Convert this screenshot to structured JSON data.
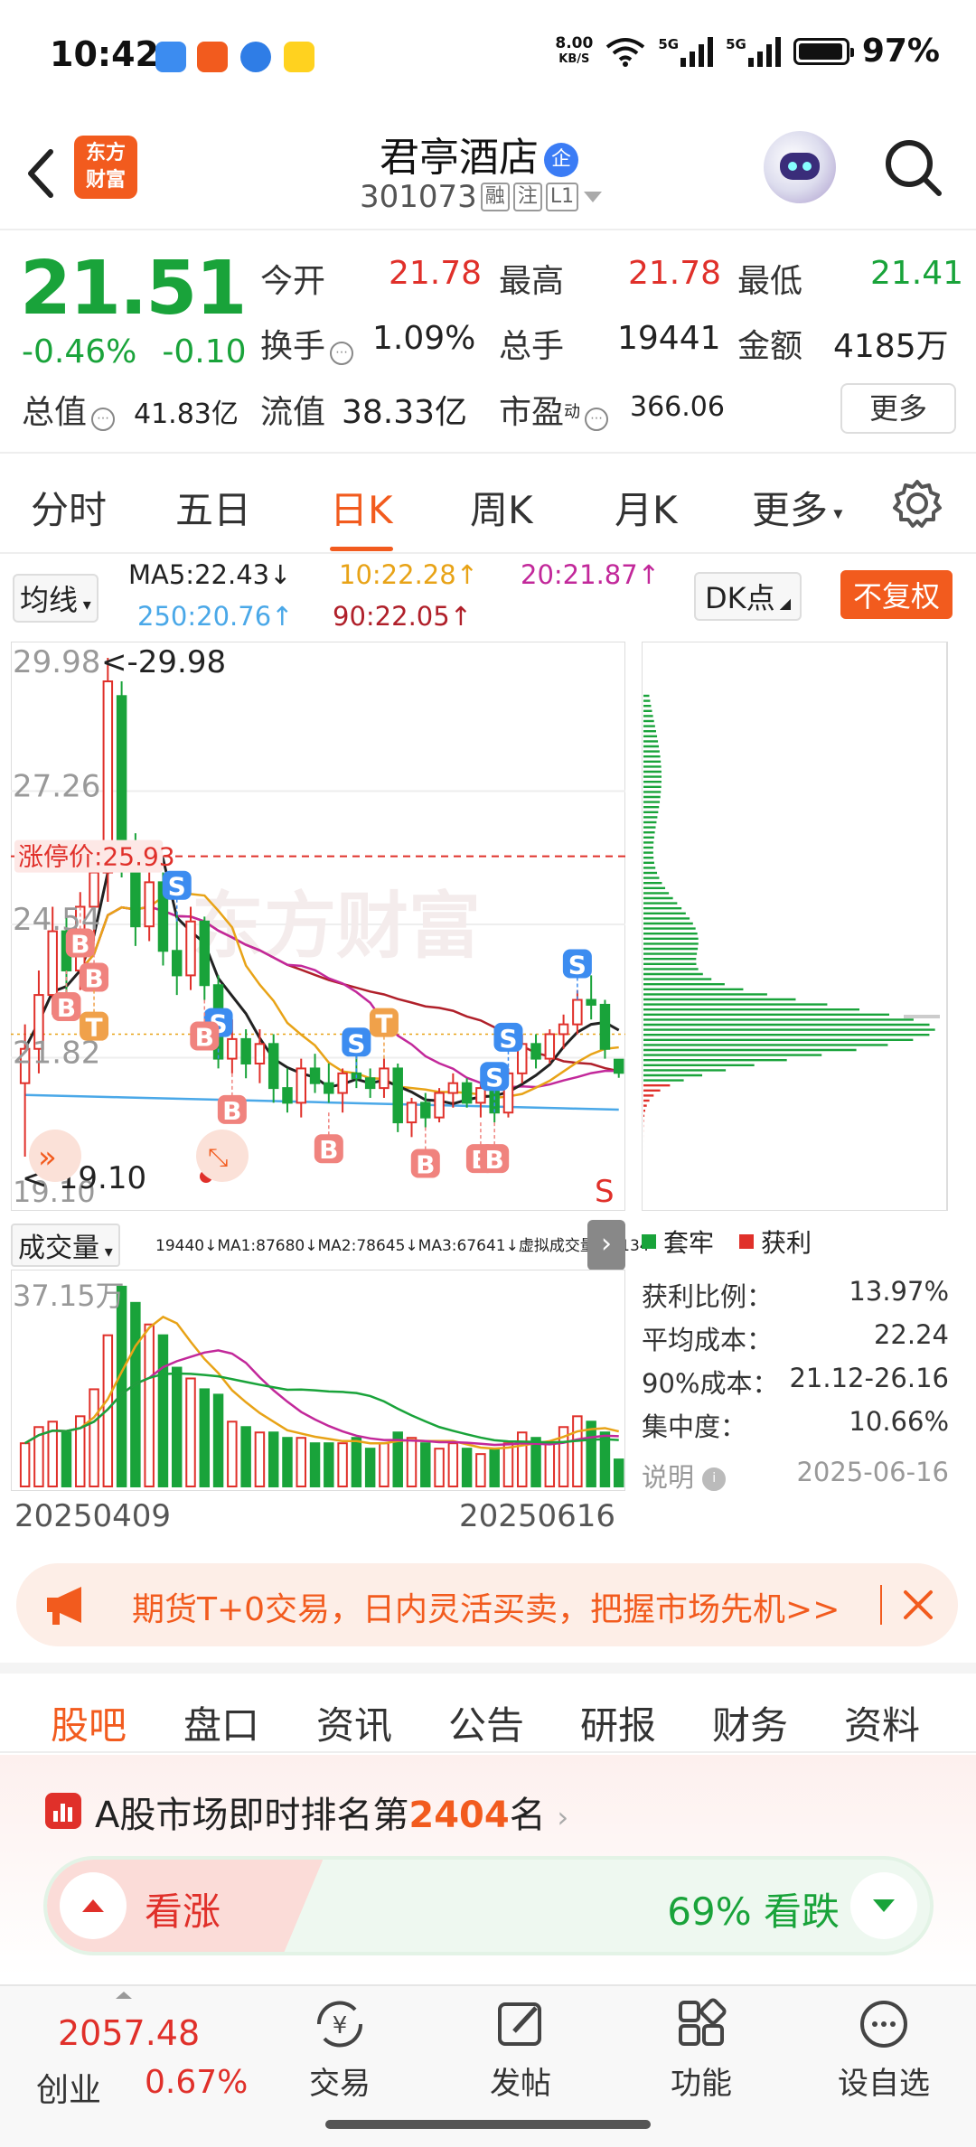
{
  "status_bar": {
    "time": "10:42",
    "net_speed": "8.00",
    "net_unit": "KB/S",
    "signal1": "5G",
    "signal2": "5G",
    "battery": "97%",
    "battery_level": 0.97
  },
  "header": {
    "back_icon": "chevron-left-icon",
    "logo_line1": "东方",
    "logo_line2": "财富",
    "stock_name": "君亭酒店",
    "name_badge": "企",
    "stock_code": "301073",
    "tags": [
      "融",
      "注",
      "L1"
    ],
    "assistant_icon": "robot-avatar-icon",
    "search_icon": "search-icon"
  },
  "quote": {
    "price": "21.51",
    "change_pct": "-0.46%",
    "change": "-0.10",
    "open_label": "今开",
    "open": "21.78",
    "high_label": "最高",
    "high": "21.78",
    "low_label": "最低",
    "low": "21.41",
    "turnover_label": "换手",
    "turnover": "1.09%",
    "volume_label": "总手",
    "volume": "19441",
    "amount_label": "金额",
    "amount": "4185万",
    "mktcap_label": "总值",
    "mktcap": "41.83亿",
    "float_label": "流值",
    "float_cap": "38.33亿",
    "pe_label": "市盈",
    "pe_sup": "动",
    "pe": "366.06",
    "more_button": "更多",
    "colors": {
      "up": "#e0302a",
      "down": "#19a33a",
      "accent": "#f25b1e"
    }
  },
  "period_tabs": {
    "items": [
      "分时",
      "五日",
      "日K",
      "周K",
      "月K",
      "更多"
    ],
    "active": "日K",
    "settings_icon": "gear-icon"
  },
  "ma_legend": {
    "selector": "均线",
    "ma5": "MA5:22.43↓",
    "ma10": "10:22.28↑",
    "ma20": "20:21.87↑",
    "ma250": "250:20.76↑",
    "ma90": "90:22.05↑",
    "dk": "DK点",
    "adjust": "不复权",
    "colors": {
      "ma5": "#222222",
      "ma10": "#e8a317",
      "ma20": "#c2289a",
      "ma250": "#4aa8e8",
      "ma90": "#b0202a"
    }
  },
  "kline": {
    "max_label": "29.98",
    "max_pointer": "<-29.98",
    "y_labels": [
      "27.26",
      "24.54",
      "21.82",
      "19.10"
    ],
    "limit_label": "涨停价:25.93",
    "min_pointer": "<-19.10",
    "watermark": "东方财富",
    "signal_s": "S",
    "signal_b": "B",
    "signal_t": "T",
    "final_signal": "S"
  },
  "chart_data": {
    "type": "candlestick",
    "title": "",
    "ylim": [
      19.1,
      29.98
    ],
    "candles": [
      {
        "o": 21.3,
        "h": 22.5,
        "l": 19.8,
        "c": 22.0
      },
      {
        "o": 22.0,
        "h": 23.6,
        "l": 21.5,
        "c": 23.1
      },
      {
        "o": 23.1,
        "h": 24.9,
        "l": 22.7,
        "c": 24.4
      },
      {
        "o": 24.4,
        "h": 24.8,
        "l": 23.0,
        "c": 23.6
      },
      {
        "o": 23.6,
        "h": 25.2,
        "l": 23.2,
        "c": 24.9
      },
      {
        "o": 24.9,
        "h": 26.2,
        "l": 24.2,
        "c": 25.6
      },
      {
        "o": 25.6,
        "h": 29.98,
        "l": 25.0,
        "c": 29.5
      },
      {
        "o": 29.2,
        "h": 29.5,
        "l": 25.5,
        "c": 26.0
      },
      {
        "o": 26.0,
        "h": 26.4,
        "l": 24.1,
        "c": 24.5
      },
      {
        "o": 24.5,
        "h": 25.9,
        "l": 24.2,
        "c": 25.4
      },
      {
        "o": 25.4,
        "h": 25.6,
        "l": 23.7,
        "c": 24.0
      },
      {
        "o": 24.0,
        "h": 24.8,
        "l": 23.1,
        "c": 23.5
      },
      {
        "o": 23.5,
        "h": 24.9,
        "l": 23.2,
        "c": 24.6
      },
      {
        "o": 24.6,
        "h": 24.7,
        "l": 23.0,
        "c": 23.3
      },
      {
        "o": 23.3,
        "h": 23.5,
        "l": 21.6,
        "c": 21.8
      },
      {
        "o": 21.8,
        "h": 22.6,
        "l": 21.5,
        "c": 22.2
      },
      {
        "o": 22.2,
        "h": 22.4,
        "l": 21.4,
        "c": 21.7
      },
      {
        "o": 21.7,
        "h": 22.4,
        "l": 21.3,
        "c": 22.1
      },
      {
        "o": 22.1,
        "h": 22.3,
        "l": 20.9,
        "c": 21.2
      },
      {
        "o": 21.2,
        "h": 21.6,
        "l": 20.7,
        "c": 20.9
      },
      {
        "o": 20.9,
        "h": 21.8,
        "l": 20.6,
        "c": 21.6
      },
      {
        "o": 21.6,
        "h": 21.9,
        "l": 21.1,
        "c": 21.3
      },
      {
        "o": 21.3,
        "h": 21.7,
        "l": 20.9,
        "c": 21.1
      },
      {
        "o": 21.1,
        "h": 21.6,
        "l": 20.7,
        "c": 21.5
      },
      {
        "o": 21.5,
        "h": 21.9,
        "l": 21.2,
        "c": 21.4
      },
      {
        "o": 21.4,
        "h": 21.6,
        "l": 21.0,
        "c": 21.2
      },
      {
        "o": 21.2,
        "h": 21.8,
        "l": 21.0,
        "c": 21.6
      },
      {
        "o": 21.6,
        "h": 21.7,
        "l": 20.3,
        "c": 20.5
      },
      {
        "o": 20.5,
        "h": 21.0,
        "l": 20.2,
        "c": 20.9
      },
      {
        "o": 20.9,
        "h": 21.1,
        "l": 20.4,
        "c": 20.6
      },
      {
        "o": 20.6,
        "h": 21.2,
        "l": 20.5,
        "c": 21.1
      },
      {
        "o": 21.1,
        "h": 21.5,
        "l": 20.8,
        "c": 21.3
      },
      {
        "o": 21.3,
        "h": 21.4,
        "l": 20.8,
        "c": 20.9
      },
      {
        "o": 20.9,
        "h": 21.3,
        "l": 20.6,
        "c": 21.2
      },
      {
        "o": 21.2,
        "h": 21.3,
        "l": 20.5,
        "c": 20.7
      },
      {
        "o": 20.7,
        "h": 21.6,
        "l": 20.6,
        "c": 21.5
      },
      {
        "o": 21.5,
        "h": 22.3,
        "l": 21.3,
        "c": 22.1
      },
      {
        "o": 22.1,
        "h": 22.3,
        "l": 21.6,
        "c": 21.8
      },
      {
        "o": 21.8,
        "h": 22.4,
        "l": 21.7,
        "c": 22.3
      },
      {
        "o": 22.3,
        "h": 22.7,
        "l": 22.0,
        "c": 22.5
      },
      {
        "o": 22.5,
        "h": 23.2,
        "l": 22.3,
        "c": 23.0
      },
      {
        "o": 23.0,
        "h": 23.5,
        "l": 22.6,
        "c": 22.9
      },
      {
        "o": 22.9,
        "h": 23.0,
        "l": 21.8,
        "c": 22.0
      },
      {
        "o": 21.78,
        "h": 21.78,
        "l": 21.41,
        "c": 21.51
      }
    ],
    "volume_series": {
      "name": "成交量",
      "max_label": "37.15万",
      "values": [
        8,
        11,
        12,
        10,
        13,
        18,
        28,
        37,
        34,
        30,
        28,
        22,
        20,
        18,
        17,
        12,
        11,
        10,
        10,
        9,
        9,
        8,
        8,
        8,
        9,
        7,
        8,
        10,
        9,
        8,
        7,
        8,
        7,
        6,
        7,
        8,
        10,
        9,
        8,
        11,
        13,
        12,
        10,
        5
      ]
    },
    "volume_legend": "19440↓MA1:87680↓MA2:78645↓MA3:67641↓虚拟成交量:68134",
    "x_start": "20250409",
    "x_end": "20250616"
  },
  "chip": {
    "legend_trap": "套牢",
    "legend_profit": "获利",
    "profit_ratio_label": "获利比例：",
    "profit_ratio": "13.97%",
    "avg_cost_label": "平均成本：",
    "avg_cost": "22.24",
    "cost90_label": "90%成本：",
    "cost90": "21.12-26.16",
    "concentration_label": "集中度：",
    "concentration": "10.66%",
    "note_label": "说明",
    "date": "2025-06-16"
  },
  "banner": {
    "icon": "megaphone-icon",
    "text": "期货T+0交易，日内灵活买卖，把握市场先机>>",
    "close_icon": "close-icon"
  },
  "section_tabs": {
    "items": [
      "股吧",
      "盘口",
      "资讯",
      "公告",
      "研报",
      "财务",
      "资料"
    ],
    "active": "股吧"
  },
  "ranking": {
    "prefix": "A股市场即时排名第",
    "rank": "2404",
    "suffix": "名",
    "bull_label": "看涨",
    "bear_label": "69% 看跌",
    "bear_pct": 0.69
  },
  "bottom_nav": {
    "index_value": "2057.48",
    "index_name": "创业",
    "index_pct": "0.67%",
    "items": [
      {
        "label": "交易",
        "icon": "yen-cycle-icon"
      },
      {
        "label": "发帖",
        "icon": "edit-icon"
      },
      {
        "label": "功能",
        "icon": "grid-icon"
      },
      {
        "label": "设自选",
        "icon": "more-dots-icon"
      }
    ]
  }
}
